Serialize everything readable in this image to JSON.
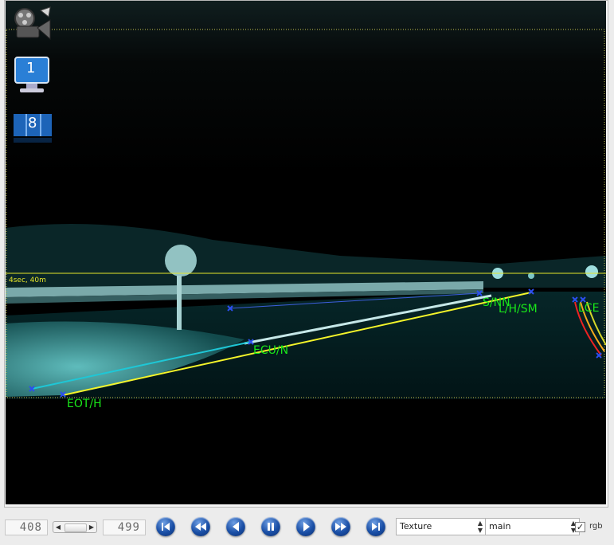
{
  "viewport": {
    "horizon_label": "4sec, 40m",
    "overlay_labels": {
      "eot": "EOT/H",
      "ecu": "ECU/N",
      "snn": "S/NN",
      "lhsm": "L/H/SM",
      "right": "LCE"
    },
    "side_icons": {
      "video_icon": "video-settings-icon",
      "monitor_label": "1",
      "counter_label": "8"
    }
  },
  "toolbar": {
    "current_frame": "408",
    "total_frames": "499",
    "render_mode": "Texture",
    "channel": "main",
    "rgb_checked": true,
    "rgb_label": "rgb"
  },
  "colors": {
    "overlay_text": "#19e619",
    "horizon_line": "#e5e52a",
    "button_blue": "#1a4fa6"
  }
}
